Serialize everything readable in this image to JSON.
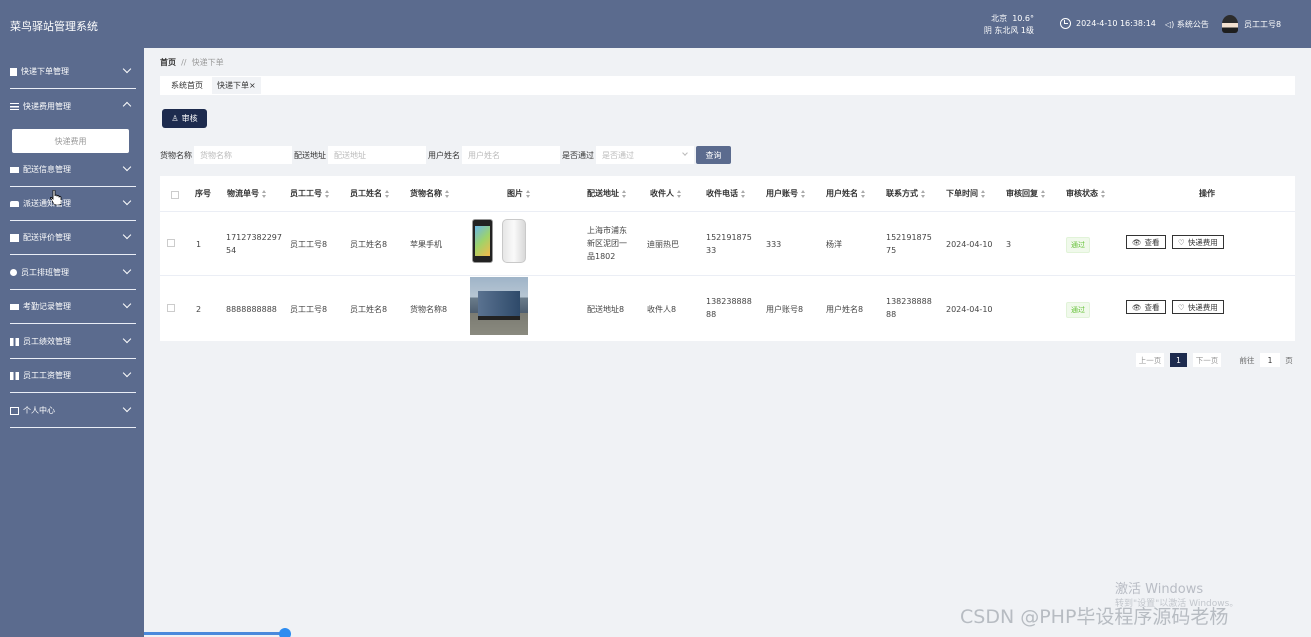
{
  "app": {
    "title": "菜鸟驿站管理系统"
  },
  "header": {
    "weather_city": "北京",
    "weather_temp": "10.6°",
    "weather_desc": "阴  东北风  1级",
    "datetime": "2024-4-10 16:38:14",
    "notice": "系统公告",
    "username": "员工工号8"
  },
  "sidebar": {
    "items": [
      {
        "label": "快递下单管理",
        "icon": "doc-icon",
        "expanded": false
      },
      {
        "label": "快递费用管理",
        "icon": "list-icon",
        "expanded": true
      },
      {
        "label": "配送信息管理",
        "icon": "truck-icon",
        "expanded": false
      },
      {
        "label": "派送通知管理",
        "icon": "bag-icon",
        "expanded": false
      },
      {
        "label": "配送评价管理",
        "icon": "grid-icon",
        "expanded": false
      },
      {
        "label": "员工排班管理",
        "icon": "bulb-icon",
        "expanded": false
      },
      {
        "label": "考勤记录管理",
        "icon": "monitor-icon",
        "expanded": false
      },
      {
        "label": "员工绩效管理",
        "icon": "grid-icon",
        "expanded": false
      },
      {
        "label": "员工工资管理",
        "icon": "grid-icon",
        "expanded": false
      },
      {
        "label": "个人中心",
        "icon": "card-icon",
        "expanded": false
      }
    ],
    "sub_item": "快递费用"
  },
  "breadcrumb": {
    "home": "首页",
    "sep": "//",
    "current": "快递下单"
  },
  "tabs": [
    {
      "label": "系统首页"
    },
    {
      "label": "快递下单×"
    }
  ],
  "toolbar": {
    "audit_label": "审核"
  },
  "search": {
    "goods_label": "货物名称",
    "goods_placeholder": "货物名称",
    "address_label": "配送地址",
    "address_placeholder": "配送地址",
    "user_label": "用户姓名",
    "user_placeholder": "用户姓名",
    "pass_label": "是否通过",
    "pass_placeholder": "是否通过",
    "query_label": "查询"
  },
  "table": {
    "columns": [
      "序号",
      "物流单号",
      "员工工号",
      "员工姓名",
      "货物名称",
      "图片",
      "配送地址",
      "收件人",
      "收件电话",
      "用户账号",
      "用户姓名",
      "联系方式",
      "下单时间",
      "审核回复",
      "审核状态",
      "操作"
    ],
    "rows": [
      {
        "index": "1",
        "tracking_l1": "17127382297",
        "tracking_l2": "54",
        "emp_no": "员工工号8",
        "emp_name": "员工姓名8",
        "goods": "苹果手机",
        "image": "phone-image",
        "addr_l1": "上海市浦东",
        "addr_l2": "新区泥团一",
        "addr_l3": "品1802",
        "receiver": "迪丽热巴",
        "rphone_l1": "152191875",
        "rphone_l2": "33",
        "account": "333",
        "uname": "杨洋",
        "contact_l1": "152191875",
        "contact_l2": "75",
        "time": "2024-04-10",
        "reply": "3",
        "status": "通过",
        "view": "查看",
        "fee": "快递费用"
      },
      {
        "index": "2",
        "tracking_l1": "8888888888",
        "tracking_l2": "",
        "emp_no": "员工工号8",
        "emp_name": "员工姓名8",
        "goods": "货物名称8",
        "image": "truck-image",
        "addr_l1": "配送地址8",
        "addr_l2": "",
        "addr_l3": "",
        "receiver": "收件人8",
        "rphone_l1": "138238888",
        "rphone_l2": "88",
        "account": "用户账号8",
        "uname": "用户姓名8",
        "contact_l1": "138238888",
        "contact_l2": "88",
        "time": "2024-04-10",
        "reply": "",
        "status": "通过",
        "view": "查看",
        "fee": "快递费用"
      }
    ]
  },
  "pager": {
    "prev": "上一页",
    "current": "1",
    "next": "下一页",
    "goto": "前往",
    "page_input": "1",
    "page_unit": "页"
  },
  "overlay": {
    "win_line1": "激活 Windows",
    "win_line2": "转到\"设置\"以激活 Windows。",
    "csdn": "CSDN @PHP毕设程序源码老杨"
  },
  "colors": {
    "header_bg": "#5b6b8e",
    "sidebar_bg": "#5b6b8e",
    "primary_btn": "#1d2b4e",
    "success": "#67c23a"
  }
}
